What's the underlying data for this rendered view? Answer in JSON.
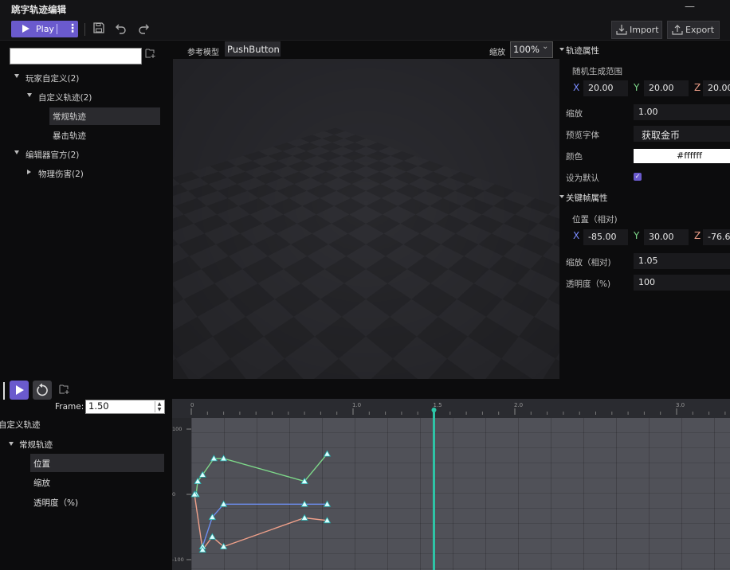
{
  "window": {
    "title": "跳字轨迹编辑",
    "minimize": "—"
  },
  "toolbar": {
    "play_label": "Play",
    "more": "⋮",
    "import_label": "Import",
    "export_label": "Export"
  },
  "tree": {
    "search_value": "",
    "items": [
      {
        "label": "玩家自定义(2)",
        "level": 0,
        "expanded": true,
        "selected": false
      },
      {
        "label": "自定义轨迹(2)",
        "level": 1,
        "expanded": true,
        "selected": false
      },
      {
        "label": "常规轨迹",
        "level": 2,
        "expanded": null,
        "selected": true
      },
      {
        "label": "暴击轨迹",
        "level": 2,
        "expanded": null,
        "selected": false
      },
      {
        "label": "编辑器官方(2)",
        "level": 0,
        "expanded": true,
        "selected": false
      },
      {
        "label": "物理伤害(2)",
        "level": 1,
        "expanded": false,
        "selected": false
      }
    ]
  },
  "viewport": {
    "ref_model_label": "参考模型",
    "ref_model_value": "PushButton",
    "zoom_label": "缩放",
    "zoom_value": "100%",
    "zoom_caret": "⌄"
  },
  "props": {
    "track_section": "轨迹属性",
    "random_range_label": "随机生成范围",
    "random": {
      "x_label": "X",
      "x": "20.00",
      "y_label": "Y",
      "y": "20.00",
      "z_label": "Z",
      "z": "20.00"
    },
    "scale_label": "缩放",
    "scale_value": "1.00",
    "font_label": "预览字体",
    "font_value": "获取金币",
    "color_label": "颜色",
    "color_value": "#ffffff",
    "default_label": "设为默认",
    "default_checked": "✓",
    "key_section": "关键帧属性",
    "position_label": "位置（相对)",
    "pos": {
      "x_label": "X",
      "x": "-85.00",
      "y_label": "Y",
      "y": "30.00",
      "z_label": "Z",
      "z": "-76.6"
    },
    "rel_scale_label": "缩放（相对)",
    "rel_scale_value": "1.05",
    "opacity_label": "透明度（%)",
    "opacity_value": "100"
  },
  "timeline_panel": {
    "frame_label": "Frame:",
    "frame_value": "1.50",
    "tree": {
      "root": "自定义轨迹",
      "track": "常规轨迹",
      "channels": [
        "位置",
        "缩放",
        "透明度（%)"
      ],
      "selected_channel": "位置"
    },
    "ruler_ticks": [
      "0",
      "1.0",
      "1.5",
      "2.0",
      "3.0"
    ],
    "value_ticks": [
      "100",
      "0",
      "-100"
    ],
    "playhead_time": 1.5
  },
  "colors": {
    "accent": "#6a5acd",
    "playhead": "#2ec4a6",
    "curve_green": "#7ed98a",
    "curve_blue": "#6c8df0",
    "curve_salmon": "#f0a08a"
  }
}
